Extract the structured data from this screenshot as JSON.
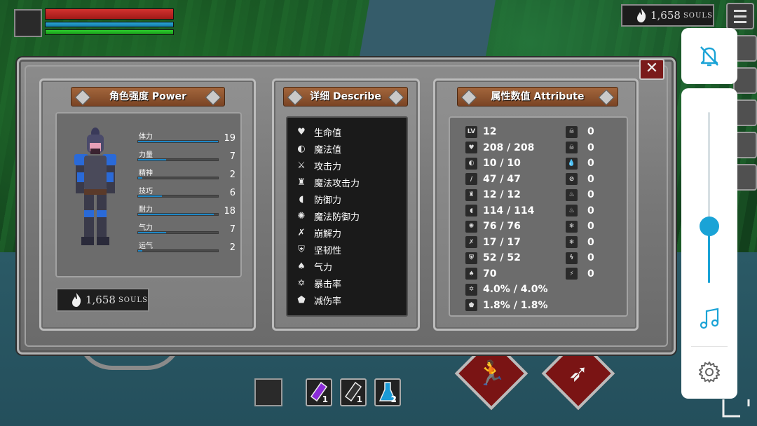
{
  "hud": {
    "hp_fraction": 1.0,
    "mp_fraction": 1.0,
    "stamina_fraction": 1.0,
    "souls_value": "1,658",
    "souls_unit": "SOULS"
  },
  "window": {
    "close_label": "✕",
    "power_title": "角色强度 Power",
    "describe_title": "详细 Describe",
    "attribute_title": "属性数值 Attribute"
  },
  "power": {
    "stats": [
      {
        "label": "体力",
        "value": "19",
        "fill": 1.0
      },
      {
        "label": "力量",
        "value": "7",
        "fill": 0.35
      },
      {
        "label": "精神",
        "value": "2",
        "fill": 0.05
      },
      {
        "label": "技巧",
        "value": "6",
        "fill": 0.3
      },
      {
        "label": "耐力",
        "value": "18",
        "fill": 0.95
      },
      {
        "label": "气力",
        "value": "7",
        "fill": 0.35
      },
      {
        "label": "运气",
        "value": "2",
        "fill": 0.05
      }
    ],
    "souls_value": "1,658",
    "souls_unit": "SOULS"
  },
  "describe": {
    "items": [
      {
        "icon": "heart-icon",
        "label": "生命值"
      },
      {
        "icon": "mana-icon",
        "label": "魔法值"
      },
      {
        "icon": "sword-icon",
        "label": "攻击力"
      },
      {
        "icon": "magic-attack-icon",
        "label": "魔法攻击力"
      },
      {
        "icon": "shield-icon",
        "label": "防御力"
      },
      {
        "icon": "magic-defense-icon",
        "label": "魔法防御力"
      },
      {
        "icon": "break-icon",
        "label": "崩解力"
      },
      {
        "icon": "helmet-icon",
        "label": "坚韧性"
      },
      {
        "icon": "lungs-icon",
        "label": "气力"
      },
      {
        "icon": "crit-icon",
        "label": "暴击率"
      },
      {
        "icon": "damage-reduction-icon",
        "label": "减伤率"
      }
    ]
  },
  "attribute": {
    "left": [
      {
        "icon": "level-icon",
        "icon_text": "LV",
        "value": "12"
      },
      {
        "icon": "heart-icon",
        "icon_text": "♥",
        "value": "208 / 208"
      },
      {
        "icon": "mana-icon",
        "icon_text": "◐",
        "value": "10 / 10"
      },
      {
        "icon": "sword-icon",
        "icon_text": "/",
        "value": "47 / 47"
      },
      {
        "icon": "magic-attack-icon",
        "icon_text": "♜",
        "value": "12 / 12"
      },
      {
        "icon": "shield-icon",
        "icon_text": "◖",
        "value": "114 / 114"
      },
      {
        "icon": "magic-defense-icon",
        "icon_text": "✺",
        "value": "76 / 76"
      },
      {
        "icon": "break-icon",
        "icon_text": "✗",
        "value": "17 / 17"
      },
      {
        "icon": "helmet-icon",
        "icon_text": "⛨",
        "value": "52 / 52"
      },
      {
        "icon": "lungs-icon",
        "icon_text": "♠",
        "value": "70"
      },
      {
        "icon": "crit-icon",
        "icon_text": "✡",
        "value": "4.0% / 4.0%"
      },
      {
        "icon": "damage-reduction-icon",
        "icon_text": "⬟",
        "value": "1.8% / 1.8%"
      }
    ],
    "right": [
      {
        "icon": "skull-icon",
        "icon_text": "☠",
        "value": "0"
      },
      {
        "icon": "poison-skull-icon",
        "icon_text": "☠",
        "value": "0"
      },
      {
        "icon": "bleed-icon",
        "icon_text": "💧",
        "value": "0"
      },
      {
        "icon": "curse-icon",
        "icon_text": "⊘",
        "value": "0"
      },
      {
        "icon": "fire-icon",
        "icon_text": "♨",
        "value": "0"
      },
      {
        "icon": "burn-icon",
        "icon_text": "♨",
        "value": "0"
      },
      {
        "icon": "frost-icon",
        "icon_text": "❄",
        "value": "0"
      },
      {
        "icon": "frost-resist-icon",
        "icon_text": "❄",
        "value": "0"
      },
      {
        "icon": "lightning-icon",
        "icon_text": "ϟ",
        "value": "0"
      },
      {
        "icon": "lightning-resist-icon",
        "icon_text": "⚡",
        "value": "0"
      }
    ]
  },
  "hotbar": {
    "potions": [
      {
        "name": "purple-potion",
        "count": "1",
        "color": "#8a2bd8"
      },
      {
        "name": "empty-potion",
        "count": "1",
        "color": "#c8c8c8"
      },
      {
        "name": "blue-potion",
        "count": "2",
        "color": "#1a9ad6"
      }
    ]
  },
  "system": {
    "volume_fraction": 0.33,
    "accent": "#1aa3d6"
  }
}
